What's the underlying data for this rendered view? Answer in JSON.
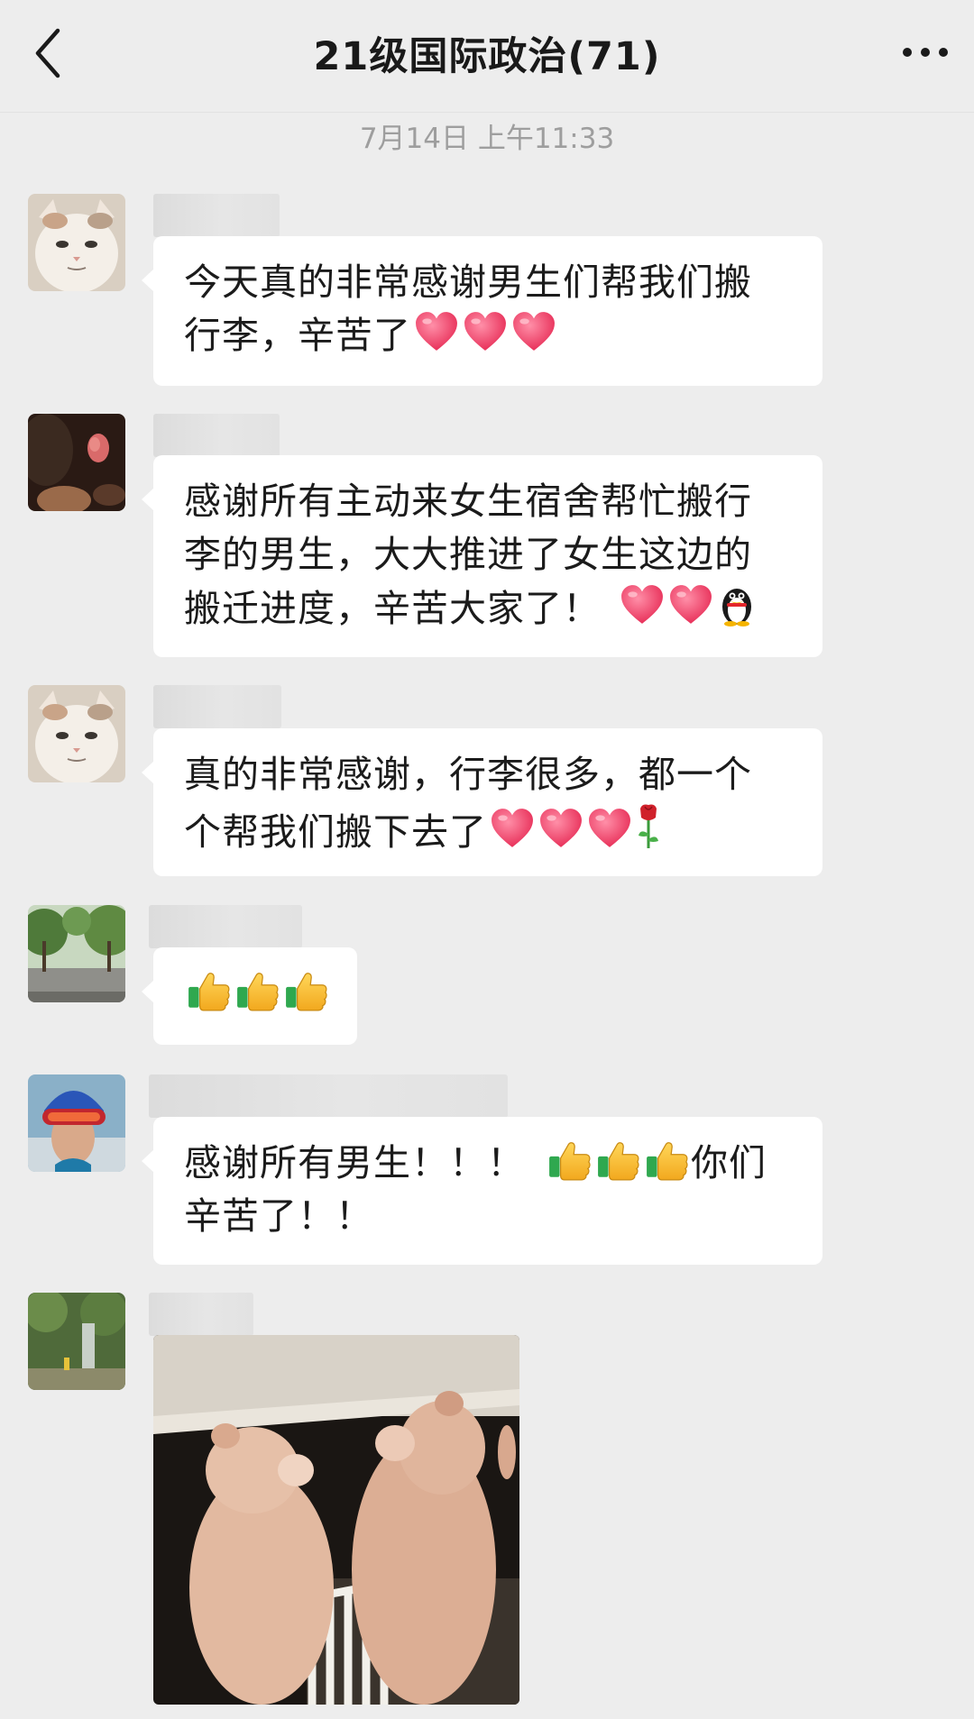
{
  "header": {
    "title": "21级国际政治(71)",
    "back_icon": "chevron-left-icon",
    "more_icon": "more-dots-icon"
  },
  "timestamp": "7月14日 上午11:33",
  "messages": [
    {
      "avatar": "cat-avatar",
      "lines": [
        "今天真的非常感谢男生们帮我们搬",
        "行李，辛苦了"
      ],
      "emoji": [
        "heart",
        "heart",
        "heart"
      ]
    },
    {
      "avatar": "rose-avatar",
      "lines": [
        "感谢所有主动来女生宿舍帮忙搬行",
        "李的男生，大大推进了女生这边的",
        "搬迁进度，辛苦大家了！"
      ],
      "emoji": [
        "heart",
        "heart",
        "penguin"
      ]
    },
    {
      "avatar": "cat-avatar",
      "lines": [
        "真的非常感谢，行李很多，都一个",
        "个帮我们搬下去了"
      ],
      "emoji": [
        "heart",
        "heart",
        "heart",
        "rose"
      ]
    },
    {
      "avatar": "trees-avatar",
      "lines": [
        ""
      ],
      "emoji": [
        "thumbs-up",
        "thumbs-up",
        "thumbs-up"
      ]
    },
    {
      "avatar": "helmet-avatar",
      "lines": [
        "感谢所有男生！！！",
        "你们",
        "辛苦了！！"
      ],
      "emoji": [
        "thumbs-up",
        "thumbs-up",
        "thumbs-up"
      ]
    },
    {
      "avatar": "waterfall-avatar",
      "image": "two-plush-bears-image"
    }
  ]
}
